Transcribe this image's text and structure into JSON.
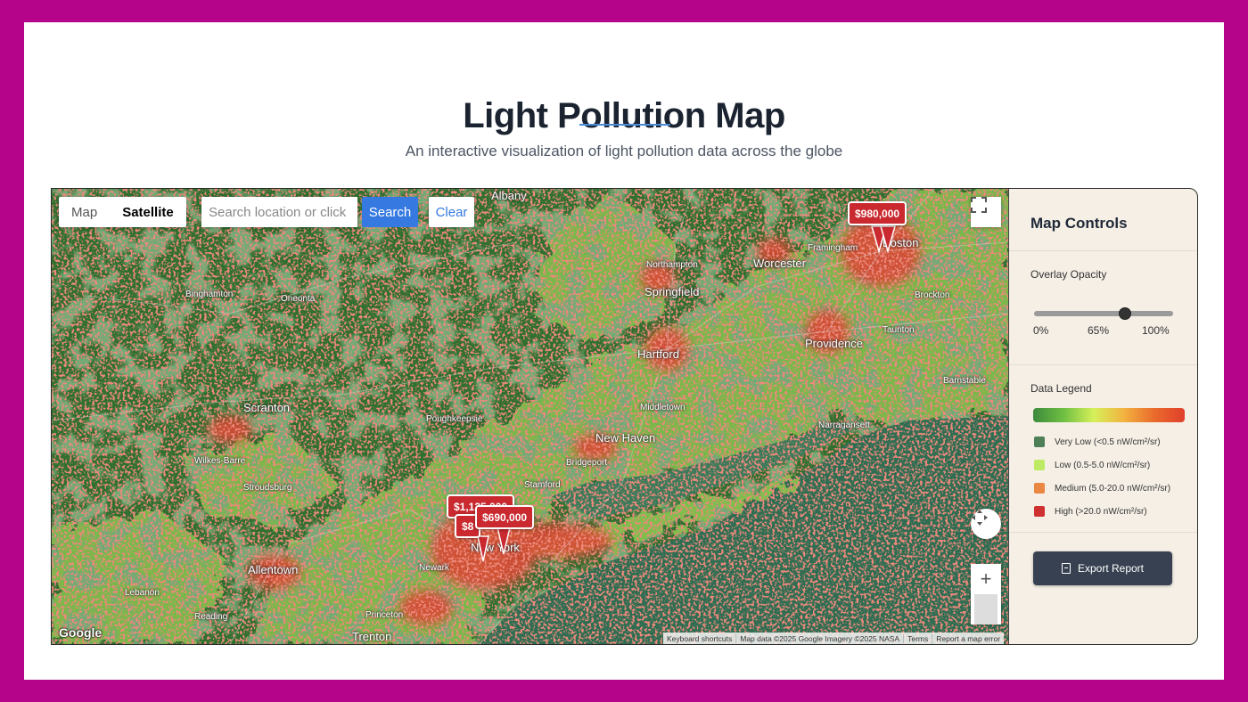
{
  "header": {
    "title": "Light Pollution Map",
    "subtitle": "An interactive visualization of light pollution data across the globe"
  },
  "map": {
    "type_toggle": {
      "map_label": "Map",
      "satellite_label": "Satellite",
      "selected": "Satellite"
    },
    "search": {
      "placeholder": "Search location or click",
      "button_label": "Search",
      "clear_label": "Clear"
    },
    "zoom": {
      "in_label": "+",
      "out_label": "−"
    },
    "google_logo": "Google",
    "attribution": {
      "shortcuts": "Keyboard shortcuts",
      "data": "Map data ©2025 Google Imagery ©2025 NASA",
      "terms": "Terms",
      "report": "Report a map error"
    },
    "markers": [
      {
        "price": "$980,000"
      },
      {
        "price": "$1,125,000"
      },
      {
        "price": "$8"
      },
      {
        "price": "$690,000"
      }
    ],
    "place_labels": [
      "Albany",
      "Boston",
      "Worcester",
      "Framingham",
      "Northampton",
      "Springfield",
      "Hartford",
      "Providence",
      "Taunton",
      "Brockton",
      "Middletown",
      "New Haven",
      "Bridgeport",
      "Stamford",
      "New York",
      "Newark",
      "Allentown",
      "Lebanon",
      "Trenton",
      "Princeton",
      "Reading",
      "Binghamton",
      "Oneonta",
      "Scranton",
      "Wilkes-Barre",
      "Stroudsburg",
      "Barnstable",
      "Narragansett",
      "Poughkeepsie"
    ]
  },
  "controls": {
    "title": "Map Controls",
    "opacity": {
      "label": "Overlay Opacity",
      "value": 65,
      "min_label": "0%",
      "value_label": "65%",
      "max_label": "100%"
    },
    "legend": {
      "label": "Data Legend",
      "items": [
        {
          "label": "Very Low (<0.5 nW/cm²/sr)",
          "color": "#4e7f57"
        },
        {
          "label": "Low (0.5-5.0 nW/cm²/sr)",
          "color": "#bdec64"
        },
        {
          "label": "Medium (5.0-20.0 nW/cm²/sr)",
          "color": "#ea8742"
        },
        {
          "label": "High (>20.0 nW/cm²/sr)",
          "color": "#cf3131"
        }
      ]
    },
    "export_label": "Export Report"
  },
  "colors": {
    "frame": "#b5038a",
    "accent": "#3679e0",
    "marker": "#c9292f",
    "water": "#2f6d52"
  }
}
